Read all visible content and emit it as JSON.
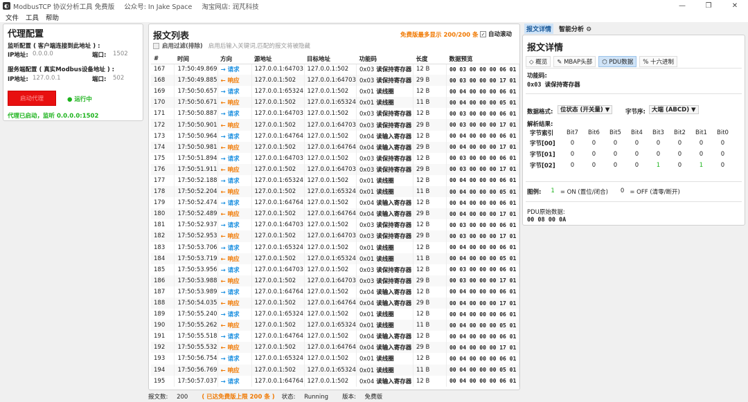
{
  "titlebar": {
    "title": "ModbusTCP 协议分析工具 免费版",
    "wechat": "公众号: In Jake Space",
    "shop": "淘宝网店: 润芃科技"
  },
  "menu": [
    "文件",
    "工具",
    "帮助"
  ],
  "left": {
    "title": "代理配置",
    "listen_label": "监听配置 ( 客户端连接到此地址 ) :",
    "listen_ip_label": "IP地址:",
    "listen_ip": "0.0.0.0",
    "listen_port_label": "端口:",
    "listen_port": "1502",
    "server_label": "服务端配置 ( 真实Modbus设备地址 ) :",
    "server_ip_label": "IP地址:",
    "server_ip": "127.0.0.1",
    "server_port_label": "端口:",
    "server_port": "502",
    "start_button": "启动代理",
    "running": "● 运行中",
    "status": "代理已启动，监听 0.0.0.0:1502"
  },
  "center": {
    "title": "报文列表",
    "limit_note": "免费版最多显示 200/200 条",
    "autoscroll": "自动滚动",
    "filter_label": "启用过滤(排除)",
    "filter_hint": "启用后输入关键词,匹配的报文将被隐藏",
    "columns": [
      "#",
      "时间",
      "方向",
      "源地址",
      "目标地址",
      "功能码",
      "长度",
      "数据预览"
    ],
    "req": "→ 请求",
    "resp": "← 响应",
    "rows": [
      [
        "167",
        "17:50:49.869",
        "req",
        "127.0.0.1:64703",
        "127.0.0.1:502",
        "0x03",
        "读保持寄存器",
        "12 B",
        "00 03 00 00 00 06 01"
      ],
      [
        "168",
        "17:50:49.885",
        "resp",
        "127.0.0.1:502",
        "127.0.0.1:64703",
        "0x03",
        "读保持寄存器",
        "29 B",
        "00 03 00 00 00 17 01"
      ],
      [
        "169",
        "17:50:50.657",
        "req",
        "127.0.0.1:65324",
        "127.0.0.1:502",
        "0x01",
        "读线圈",
        "12 B",
        "00 04 00 00 00 06 01"
      ],
      [
        "170",
        "17:50:50.671",
        "resp",
        "127.0.0.1:502",
        "127.0.0.1:65324",
        "0x01",
        "读线圈",
        "11 B",
        "00 04 00 00 00 05 01"
      ],
      [
        "171",
        "17:50:50.887",
        "req",
        "127.0.0.1:64703",
        "127.0.0.1:502",
        "0x03",
        "读保持寄存器",
        "12 B",
        "00 03 00 00 00 06 01"
      ],
      [
        "172",
        "17:50:50.901",
        "resp",
        "127.0.0.1:502",
        "127.0.0.1:64703",
        "0x03",
        "读保持寄存器",
        "29 B",
        "00 03 00 00 00 17 01"
      ],
      [
        "173",
        "17:50:50.964",
        "req",
        "127.0.0.1:64764",
        "127.0.0.1:502",
        "0x04",
        "读输入寄存器",
        "12 B",
        "00 04 00 00 00 06 01"
      ],
      [
        "174",
        "17:50:50.981",
        "resp",
        "127.0.0.1:502",
        "127.0.0.1:64764",
        "0x04",
        "读输入寄存器",
        "29 B",
        "00 04 00 00 00 17 01"
      ],
      [
        "175",
        "17:50:51.894",
        "req",
        "127.0.0.1:64703",
        "127.0.0.1:502",
        "0x03",
        "读保持寄存器",
        "12 B",
        "00 03 00 00 00 06 01"
      ],
      [
        "176",
        "17:50:51.911",
        "resp",
        "127.0.0.1:502",
        "127.0.0.1:64703",
        "0x03",
        "读保持寄存器",
        "29 B",
        "00 03 00 00 00 17 01"
      ],
      [
        "177",
        "17:50:52.188",
        "req",
        "127.0.0.1:65324",
        "127.0.0.1:502",
        "0x01",
        "读线圈",
        "12 B",
        "00 04 00 00 00 06 01"
      ],
      [
        "178",
        "17:50:52.204",
        "resp",
        "127.0.0.1:502",
        "127.0.0.1:65324",
        "0x01",
        "读线圈",
        "11 B",
        "00 04 00 00 00 05 01"
      ],
      [
        "179",
        "17:50:52.474",
        "req",
        "127.0.0.1:64764",
        "127.0.0.1:502",
        "0x04",
        "读输入寄存器",
        "12 B",
        "00 04 00 00 00 06 01"
      ],
      [
        "180",
        "17:50:52.489",
        "resp",
        "127.0.0.1:502",
        "127.0.0.1:64764",
        "0x04",
        "读输入寄存器",
        "29 B",
        "00 04 00 00 00 17 01"
      ],
      [
        "181",
        "17:50:52.937",
        "req",
        "127.0.0.1:64703",
        "127.0.0.1:502",
        "0x03",
        "读保持寄存器",
        "12 B",
        "00 03 00 00 00 06 01"
      ],
      [
        "182",
        "17:50:52.953",
        "resp",
        "127.0.0.1:502",
        "127.0.0.1:64703",
        "0x03",
        "读保持寄存器",
        "29 B",
        "00 03 00 00 00 17 01"
      ],
      [
        "183",
        "17:50:53.706",
        "req",
        "127.0.0.1:65324",
        "127.0.0.1:502",
        "0x01",
        "读线圈",
        "12 B",
        "00 04 00 00 00 06 01"
      ],
      [
        "184",
        "17:50:53.719",
        "resp",
        "127.0.0.1:502",
        "127.0.0.1:65324",
        "0x01",
        "读线圈",
        "11 B",
        "00 04 00 00 00 05 01"
      ],
      [
        "185",
        "17:50:53.956",
        "req",
        "127.0.0.1:64703",
        "127.0.0.1:502",
        "0x03",
        "读保持寄存器",
        "12 B",
        "00 03 00 00 00 06 01"
      ],
      [
        "186",
        "17:50:53.988",
        "resp",
        "127.0.0.1:502",
        "127.0.0.1:64703",
        "0x03",
        "读保持寄存器",
        "29 B",
        "00 03 00 00 00 17 01"
      ],
      [
        "187",
        "17:50:53.989",
        "req",
        "127.0.0.1:64764",
        "127.0.0.1:502",
        "0x04",
        "读输入寄存器",
        "12 B",
        "00 04 00 00 00 06 01"
      ],
      [
        "188",
        "17:50:54.035",
        "resp",
        "127.0.0.1:502",
        "127.0.0.1:64764",
        "0x04",
        "读输入寄存器",
        "29 B",
        "00 04 00 00 00 17 01"
      ],
      [
        "189",
        "17:50:55.240",
        "req",
        "127.0.0.1:65324",
        "127.0.0.1:502",
        "0x01",
        "读线圈",
        "12 B",
        "00 04 00 00 00 06 01"
      ],
      [
        "190",
        "17:50:55.262",
        "resp",
        "127.0.0.1:502",
        "127.0.0.1:65324",
        "0x01",
        "读线圈",
        "11 B",
        "00 04 00 00 00 05 01"
      ],
      [
        "191",
        "17:50:55.518",
        "req",
        "127.0.0.1:64764",
        "127.0.0.1:502",
        "0x04",
        "读输入寄存器",
        "12 B",
        "00 04 00 00 00 06 01"
      ],
      [
        "192",
        "17:50:55.532",
        "resp",
        "127.0.0.1:502",
        "127.0.0.1:64764",
        "0x04",
        "读输入寄存器",
        "29 B",
        "00 04 00 00 00 17 01"
      ],
      [
        "193",
        "17:50:56.754",
        "req",
        "127.0.0.1:65324",
        "127.0.0.1:502",
        "0x01",
        "读线圈",
        "12 B",
        "00 04 00 00 00 06 01"
      ],
      [
        "194",
        "17:50:56.769",
        "resp",
        "127.0.0.1:502",
        "127.0.0.1:65324",
        "0x01",
        "读线圈",
        "11 B",
        "00 04 00 00 00 05 01"
      ],
      [
        "195",
        "17:50:57.037",
        "req",
        "127.0.0.1:64764",
        "127.0.0.1:502",
        "0x04",
        "读输入寄存器",
        "12 B",
        "00 04 00 00 00 06 01"
      ]
    ]
  },
  "status": {
    "count_label": "报文数:",
    "count": "200",
    "limit": "( 已达免费版上限 200 条 )",
    "state_label": "状态:",
    "state": "Running",
    "version_label": "版本:",
    "version": "免费版"
  },
  "right": {
    "tabs": [
      "报文详情",
      "智能分析 ⚙"
    ],
    "title": "报文详情",
    "subtabs": [
      "◇ 概览",
      "MBAP头部",
      "PDU数据",
      "十六进制"
    ],
    "func_label": "功能码:",
    "func_value": "0x03 读保持寄存器",
    "format_label": "数据格式:",
    "format_value": "位状态 (开关量) ▼",
    "order_label": "字节序:",
    "order_value": "大端 (ABCD) ▼",
    "result_label": "解析结果:",
    "bit_header": [
      "字节索引",
      "Bit7",
      "Bit6",
      "Bit5",
      "Bit4",
      "Bit3",
      "Bit2",
      "Bit1",
      "Bit0"
    ],
    "bit_rows": [
      [
        "字节[00]",
        "0",
        "0",
        "0",
        "0",
        "0",
        "0",
        "0",
        "0"
      ],
      [
        "字节[01]",
        "0",
        "0",
        "0",
        "0",
        "0",
        "0",
        "0",
        "0"
      ],
      [
        "字节[02]",
        "0",
        "0",
        "0",
        "0",
        "1",
        "0",
        "1",
        "0"
      ]
    ],
    "legend_label": "图例:",
    "legend_on_val": "1",
    "legend_on": "= ON (置位/闭合)",
    "legend_off_val": "0",
    "legend_off": "= OFF (清零/断开)",
    "pdu_label": "PDU原始数据:",
    "pdu_value": "00 08 00 0A"
  }
}
